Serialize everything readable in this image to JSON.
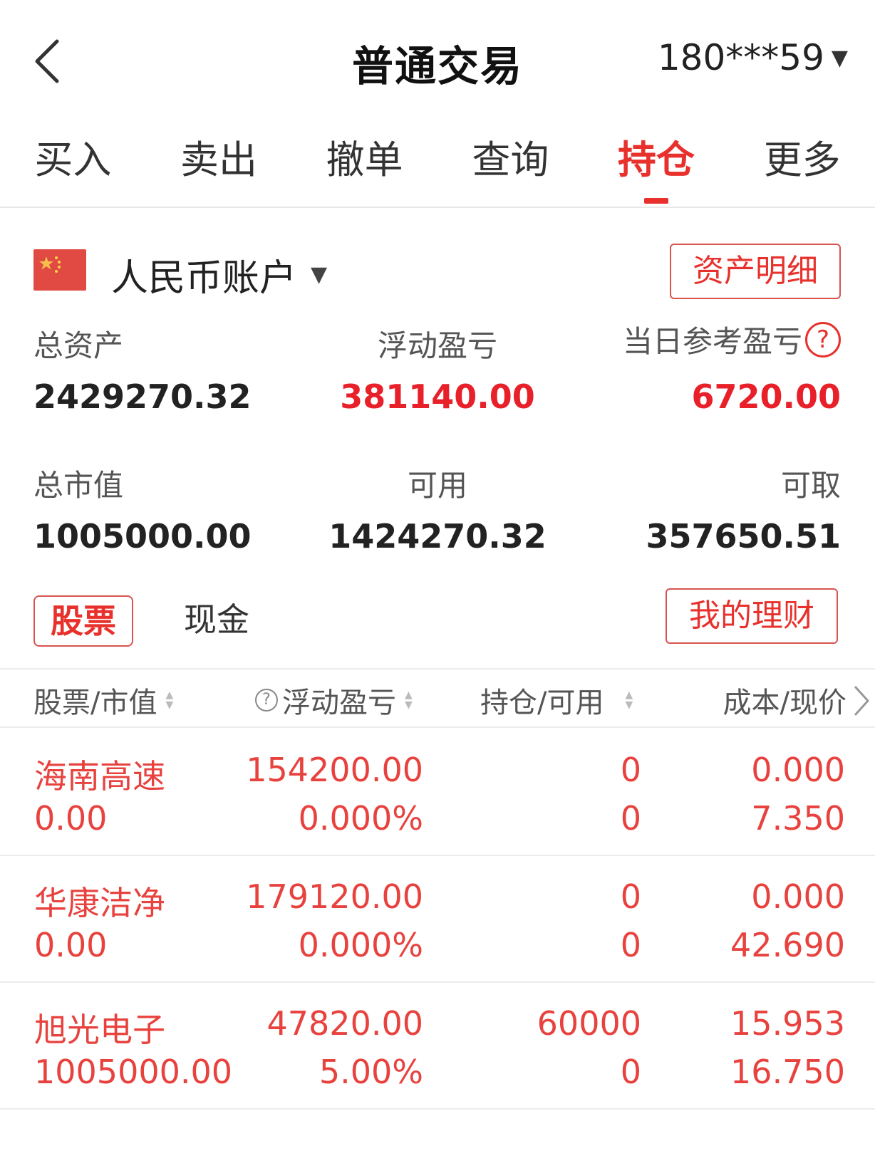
{
  "header": {
    "title": "普通交易",
    "account": "180***59"
  },
  "tabs": [
    {
      "label": "买入",
      "active": false
    },
    {
      "label": "卖出",
      "active": false
    },
    {
      "label": "撤单",
      "active": false
    },
    {
      "label": "查询",
      "active": false
    },
    {
      "label": "持仓",
      "active": true
    },
    {
      "label": "更多",
      "active": false
    }
  ],
  "account": {
    "name": "人民币账户",
    "asset_detail_button": "资产明细"
  },
  "stats": {
    "total_assets_label": "总资产",
    "total_assets": "2429270.32",
    "floating_pl_label": "浮动盈亏",
    "floating_pl": "381140.00",
    "daily_pl_label": "当日参考盈亏",
    "daily_pl": "6720.00",
    "market_value_label": "总市值",
    "market_value": "1005000.00",
    "available_label": "可用",
    "available": "1424270.32",
    "withdrawable_label": "可取",
    "withdrawable": "357650.51"
  },
  "sub_tabs": {
    "stock": "股票",
    "cash": "现金",
    "my_finance_button": "我的理财"
  },
  "table": {
    "headers": [
      "股票/市值",
      "浮动盈亏",
      "持仓/可用",
      "成本/现价"
    ],
    "rows": [
      {
        "name": "海南高速",
        "market_value": "0.00",
        "pl": "154200.00",
        "pl_pct": "0.000%",
        "position": "0",
        "available": "0",
        "cost": "0.000",
        "price": "7.350"
      },
      {
        "name": "华康洁净",
        "market_value": "0.00",
        "pl": "179120.00",
        "pl_pct": "0.000%",
        "position": "0",
        "available": "0",
        "cost": "0.000",
        "price": "42.690"
      },
      {
        "name": "旭光电子",
        "market_value": "1005000.00",
        "pl": "47820.00",
        "pl_pct": "5.00%",
        "position": "60000",
        "available": "0",
        "cost": "15.953",
        "price": "16.750"
      }
    ]
  },
  "colors": {
    "accent": "#e8312c",
    "row_text": "#e8423e"
  }
}
